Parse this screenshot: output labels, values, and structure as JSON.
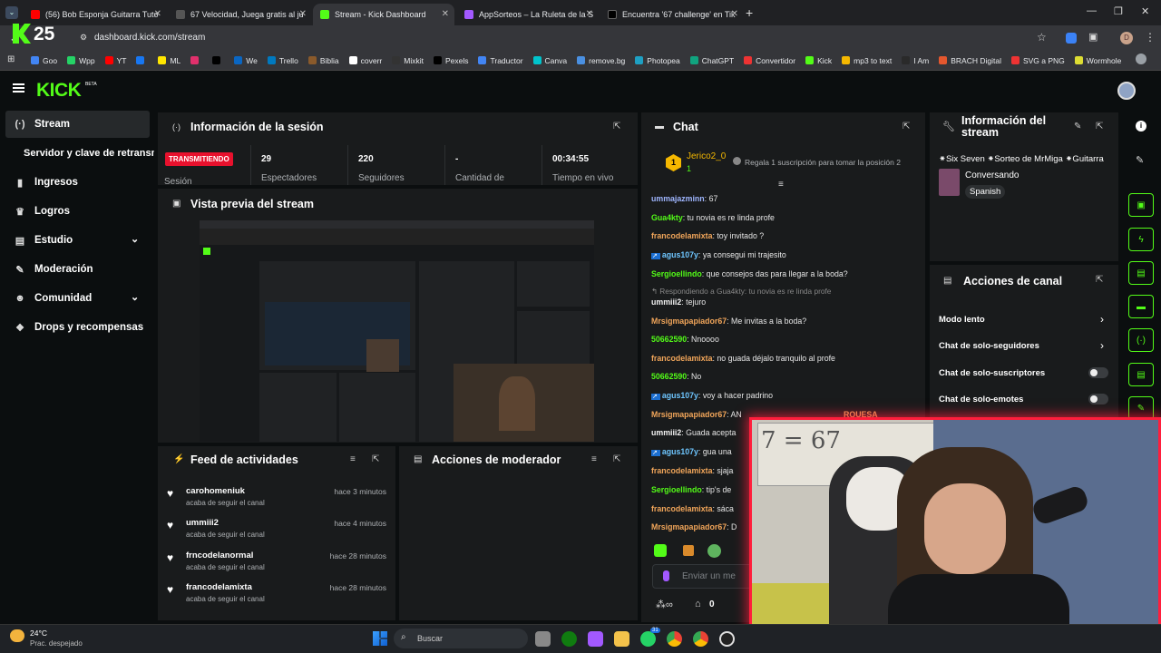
{
  "browser": {
    "tabs": [
      {
        "label": "(56) Bob Esponja Guitarra Tuto",
        "color": "#ff0000"
      },
      {
        "label": "67 Velocidad, Juega gratis al ju",
        "color": "#444"
      },
      {
        "label": "Stream - Kick Dashboard",
        "color": "#53fc18"
      },
      {
        "label": "AppSorteos – La Ruleta de la S",
        "color": "#a259ff"
      },
      {
        "label": "Encuentra '67 challenge' en Tik",
        "color": "#111"
      }
    ],
    "url": "dashboard.kick.com/stream",
    "bookmarks": [
      "Goo",
      "Wpp",
      "YT",
      "",
      "ML",
      "",
      "",
      "We",
      "Trello",
      "Biblia",
      "coverr",
      "Mixkit",
      "Pexels",
      "Traductor",
      "Canva",
      "remove.bg",
      "Photopea",
      "ChatGPT",
      "Convertidor",
      "Kick",
      "mp3 to text",
      "I Am",
      "BRACH Digital",
      "SVG a PNG",
      "Wormhole"
    ],
    "profile_initial": "D"
  },
  "kick": {
    "logo": "KICK",
    "logo_badge": "BETA",
    "overlay_number": "25"
  },
  "sidebar": {
    "items": [
      {
        "label": "Stream",
        "icon": "broadcast-icon"
      },
      {
        "label": "Servidor y clave de retransm",
        "icon": ""
      },
      {
        "label": "Ingresos",
        "icon": "chart-icon"
      },
      {
        "label": "Logros",
        "icon": "trophy-icon"
      },
      {
        "label": "Estudio",
        "icon": "layout-icon"
      },
      {
        "label": "Moderación",
        "icon": "wrench-icon"
      },
      {
        "label": "Comunidad",
        "icon": "community-icon"
      },
      {
        "label": "Drops y recompensas",
        "icon": "drops-icon"
      }
    ]
  },
  "session": {
    "title": "Información de la sesión",
    "status": "TRANSMITIENDO",
    "status_label": "Sesión",
    "stats": [
      {
        "value": "29",
        "label": "Espectadores"
      },
      {
        "value": "220",
        "label": "Seguidores"
      },
      {
        "value": "-",
        "label": "Cantidad de"
      },
      {
        "value": "00:34:55",
        "label": "Tiempo en vivo"
      }
    ]
  },
  "preview": {
    "title": "Vista previa del stream"
  },
  "activity": {
    "title": "Feed de actividades",
    "items": [
      {
        "name": "carohomeniuk",
        "action": "acaba de seguir el canal",
        "time": "hace 3 minutos"
      },
      {
        "name": "ummiii2",
        "action": "acaba de seguir el canal",
        "time": "hace 4 minutos"
      },
      {
        "name": "frncodelanormal",
        "action": "acaba de seguir el canal",
        "time": "hace 28 minutos"
      },
      {
        "name": "francodelamixta",
        "action": "acaba de seguir el canal",
        "time": "hace 28 minutos"
      }
    ]
  },
  "modactions": {
    "title": "Acciones de moderador"
  },
  "chat": {
    "title": "Chat",
    "top_user": "Jerico2_0",
    "top_count": "1",
    "gift_text": "Regala 1 suscripción para tomar la posición 2",
    "messages": [
      {
        "user": "ummajazminn",
        "text": "67",
        "color": "#9fb6ff"
      },
      {
        "user": "Gua4kty",
        "text": "tu novia es re linda profe",
        "color": "#53fc18"
      },
      {
        "user": "francodelamixta",
        "text": "toy invitado ?",
        "color": "#f2a65a"
      },
      {
        "user": "agus107y",
        "text": "ya consegui mi trajesito",
        "color": "#6ec6ff"
      },
      {
        "user": "Sergioellindo",
        "text": "que consejos das para llegar a la boda?",
        "color": "#53fc18"
      },
      {
        "user": "",
        "text": "Respondiendo a Gua4kty: tu novia es re linda profe",
        "color": "#888"
      },
      {
        "user": "ummiii2",
        "text": "tejuro",
        "color": "#f5f5f5"
      },
      {
        "user": "Mrsigmapapiador67",
        "text": "Me invitas a la boda?",
        "color": "#f2a65a"
      },
      {
        "user": "50662590",
        "text": "Nnoooo",
        "color": "#53fc18"
      },
      {
        "user": "francodelamixta",
        "text": "no guada déjalo tranquilo al profe",
        "color": "#f2a65a"
      },
      {
        "user": "50662590",
        "text": "No",
        "color": "#53fc18"
      },
      {
        "user": "agus107y",
        "text": "voy a hacer padrino",
        "color": "#6ec6ff"
      },
      {
        "user": "Mrsigmapapiador67",
        "text": "AN",
        "color": "#f2a65a"
      },
      {
        "user": "ummiii2",
        "text": "Guada acepta",
        "color": "#f5f5f5"
      },
      {
        "user": "agus107y",
        "text": "gua una",
        "color": "#6ec6ff"
      },
      {
        "user": "francodelamixta",
        "text": "sjaja",
        "color": "#f2a65a"
      },
      {
        "user": "Sergioellindo",
        "text": "tip's de",
        "color": "#53fc18"
      },
      {
        "user": "francodelamixta",
        "text": "sáca",
        "color": "#f2a65a"
      },
      {
        "user": "Mrsigmapapiador67",
        "text": "D",
        "color": "#f2a65a"
      }
    ],
    "tail_text": "RQUESA",
    "input_placeholder": "Enviar un me",
    "footer_count": "0"
  },
  "stream_info": {
    "title": "Información del stream",
    "stream_title": "⁕Six Seven ⁕Sorteo de MrMiga ⁕Guitarra",
    "category": "Conversando",
    "language": "Spanish"
  },
  "channel_actions": {
    "title": "Acciones de canal",
    "items": [
      "Modo lento",
      "Chat de solo-seguidores",
      "Chat de solo-suscriptores",
      "Chat de solo-emotes"
    ]
  },
  "webcam": {
    "board_text": "7 = 67"
  },
  "taskbar": {
    "temp": "24°C",
    "weather": "Prac. despejado",
    "search": "Buscar",
    "badge": "31"
  }
}
